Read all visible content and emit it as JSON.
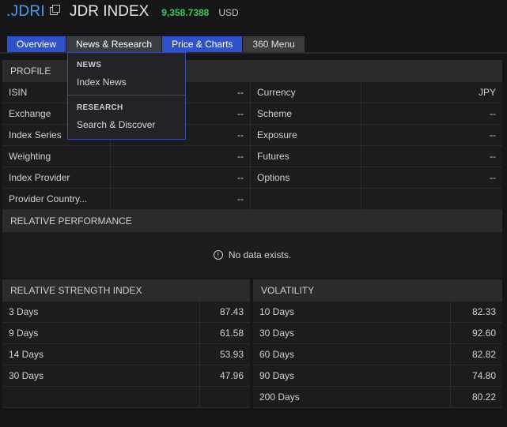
{
  "header": {
    "ric": ".JDRI",
    "title": "JDR INDEX",
    "price": "9,358.7388",
    "currency": "USD"
  },
  "tabs": [
    {
      "label": "Overview"
    },
    {
      "label": "News & Research"
    },
    {
      "label": "Price & Charts"
    },
    {
      "label": "360 Menu"
    }
  ],
  "dropdown": {
    "sections": [
      {
        "heading": "NEWS",
        "items": [
          "Index News"
        ]
      },
      {
        "heading": "RESEARCH",
        "items": [
          "Search & Discover"
        ]
      }
    ]
  },
  "profile": {
    "heading": "PROFILE",
    "rows": [
      {
        "l_label": "ISIN",
        "l_value": "--",
        "r_label": "Currency",
        "r_value": "JPY"
      },
      {
        "l_label": "Exchange",
        "l_value": "--",
        "r_label": "Scheme",
        "r_value": "--"
      },
      {
        "l_label": "Index Series",
        "l_value": "--",
        "r_label": "Exposure",
        "r_value": "--"
      },
      {
        "l_label": "Weighting",
        "l_value": "--",
        "r_label": "Futures",
        "r_value": "--"
      },
      {
        "l_label": "Index Provider",
        "l_value": "--",
        "r_label": "Options",
        "r_value": "--"
      },
      {
        "l_label": "Provider Country...",
        "l_value": "--",
        "r_label": "",
        "r_value": ""
      }
    ]
  },
  "relative_performance": {
    "heading": "RELATIVE PERFORMANCE",
    "message": "No data exists."
  },
  "rsi": {
    "heading": "RELATIVE STRENGTH INDEX",
    "rows": [
      {
        "label": "3 Days",
        "value": "87.43"
      },
      {
        "label": "9 Days",
        "value": "61.58"
      },
      {
        "label": "14 Days",
        "value": "53.93"
      },
      {
        "label": "30 Days",
        "value": "47.96"
      },
      {
        "label": "",
        "value": ""
      }
    ]
  },
  "volatility": {
    "heading": "VOLATILITY",
    "rows": [
      {
        "label": "10 Days",
        "value": "82.33"
      },
      {
        "label": "30 Days",
        "value": "92.60"
      },
      {
        "label": "60 Days",
        "value": "82.82"
      },
      {
        "label": "90 Days",
        "value": "74.80"
      },
      {
        "label": "200 Days",
        "value": "80.22"
      }
    ]
  },
  "colors": {
    "accent_blue": "#2f51c9",
    "price_green": "#3ec760",
    "ric_blue": "#4a9ff5",
    "background": "#161618"
  }
}
